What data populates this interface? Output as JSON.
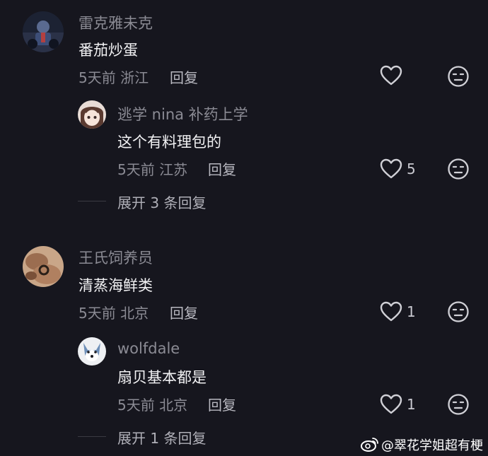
{
  "comments": [
    {
      "name": "雷克雅未克",
      "text": "番茄炒蛋",
      "meta": "5天前 浙江",
      "reply_label": "回复",
      "likes": "",
      "avatar_icon": "dark-motorcycle-avatar",
      "replies": [
        {
          "name": "逃学 nina 补药上学",
          "text": "这个有料理包的",
          "meta": "5天前 江苏",
          "reply_label": "回复",
          "likes": "5",
          "avatar_icon": "anime-girl-avatar"
        }
      ],
      "expand_label": "展开 3 条回复"
    },
    {
      "name": "王氏饲养员",
      "text": "清蒸海鲜类",
      "meta": "5天前 北京",
      "reply_label": "回复",
      "likes": "1",
      "avatar_icon": "hands-photo-avatar",
      "replies": [
        {
          "name": "wolfdale",
          "text": "扇贝基本都是",
          "meta": "5天前 北京",
          "reply_label": "回复",
          "likes": "1",
          "avatar_icon": "wolf-avatar"
        }
      ],
      "expand_label": "展开 1 条回复"
    }
  ],
  "watermark": {
    "text": "@翠花学姐超有梗",
    "icon": "weibo-icon"
  },
  "colors": {
    "background": "#16161e",
    "secondary_text": "#8b8b94",
    "primary_text": "#f2f2f4",
    "icon_stroke": "#d0d0d6"
  }
}
